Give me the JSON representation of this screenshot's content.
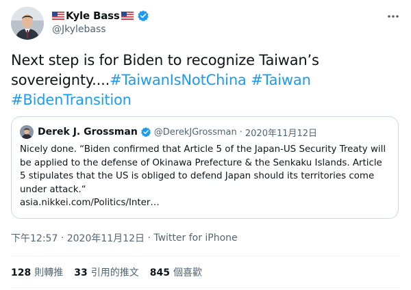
{
  "author": {
    "display_name": "Kyle Bass",
    "handle": "@Jkylebass"
  },
  "tweet": {
    "text_plain": "Next step is for Biden to recognize Taiwan’s sovereignty....",
    "hashtags": [
      "#TaiwanIsNotChina",
      "#Taiwan",
      "#BidenTransition"
    ]
  },
  "quoted_tweet": {
    "display_name": "Derek J. Grossman",
    "handle": "@DerekJGrossman",
    "separator": "·",
    "date": "2020年11月12日",
    "text": "Nicely done. “Biden confirmed that Article 5 of the Japan-US Security Treaty will be applied to the defense of Okinawa Prefecture & the Senkaku Islands. Article 5 stipulates that the US is obliged to defend Japan should its territories come under attack.“",
    "link": "asia.nikkei.com/Politics/Inter…"
  },
  "meta": {
    "time": "下午12:57",
    "separator1": "·",
    "date": "2020年11月12日",
    "separator2": "·",
    "source": "Twitter for iPhone"
  },
  "stats": [
    {
      "count": "128",
      "label": "則轉推"
    },
    {
      "count": "33",
      "label": "引用的推文"
    },
    {
      "count": "845",
      "label": "個喜歡"
    }
  ],
  "colors": {
    "accent": "#1d9bf0",
    "text": "#0f1419",
    "secondary": "#536471",
    "border": "#cfd9de"
  },
  "icons": {
    "flag": "us-flag-icon",
    "verified": "verified-badge-icon",
    "more": "more-options-icon"
  }
}
